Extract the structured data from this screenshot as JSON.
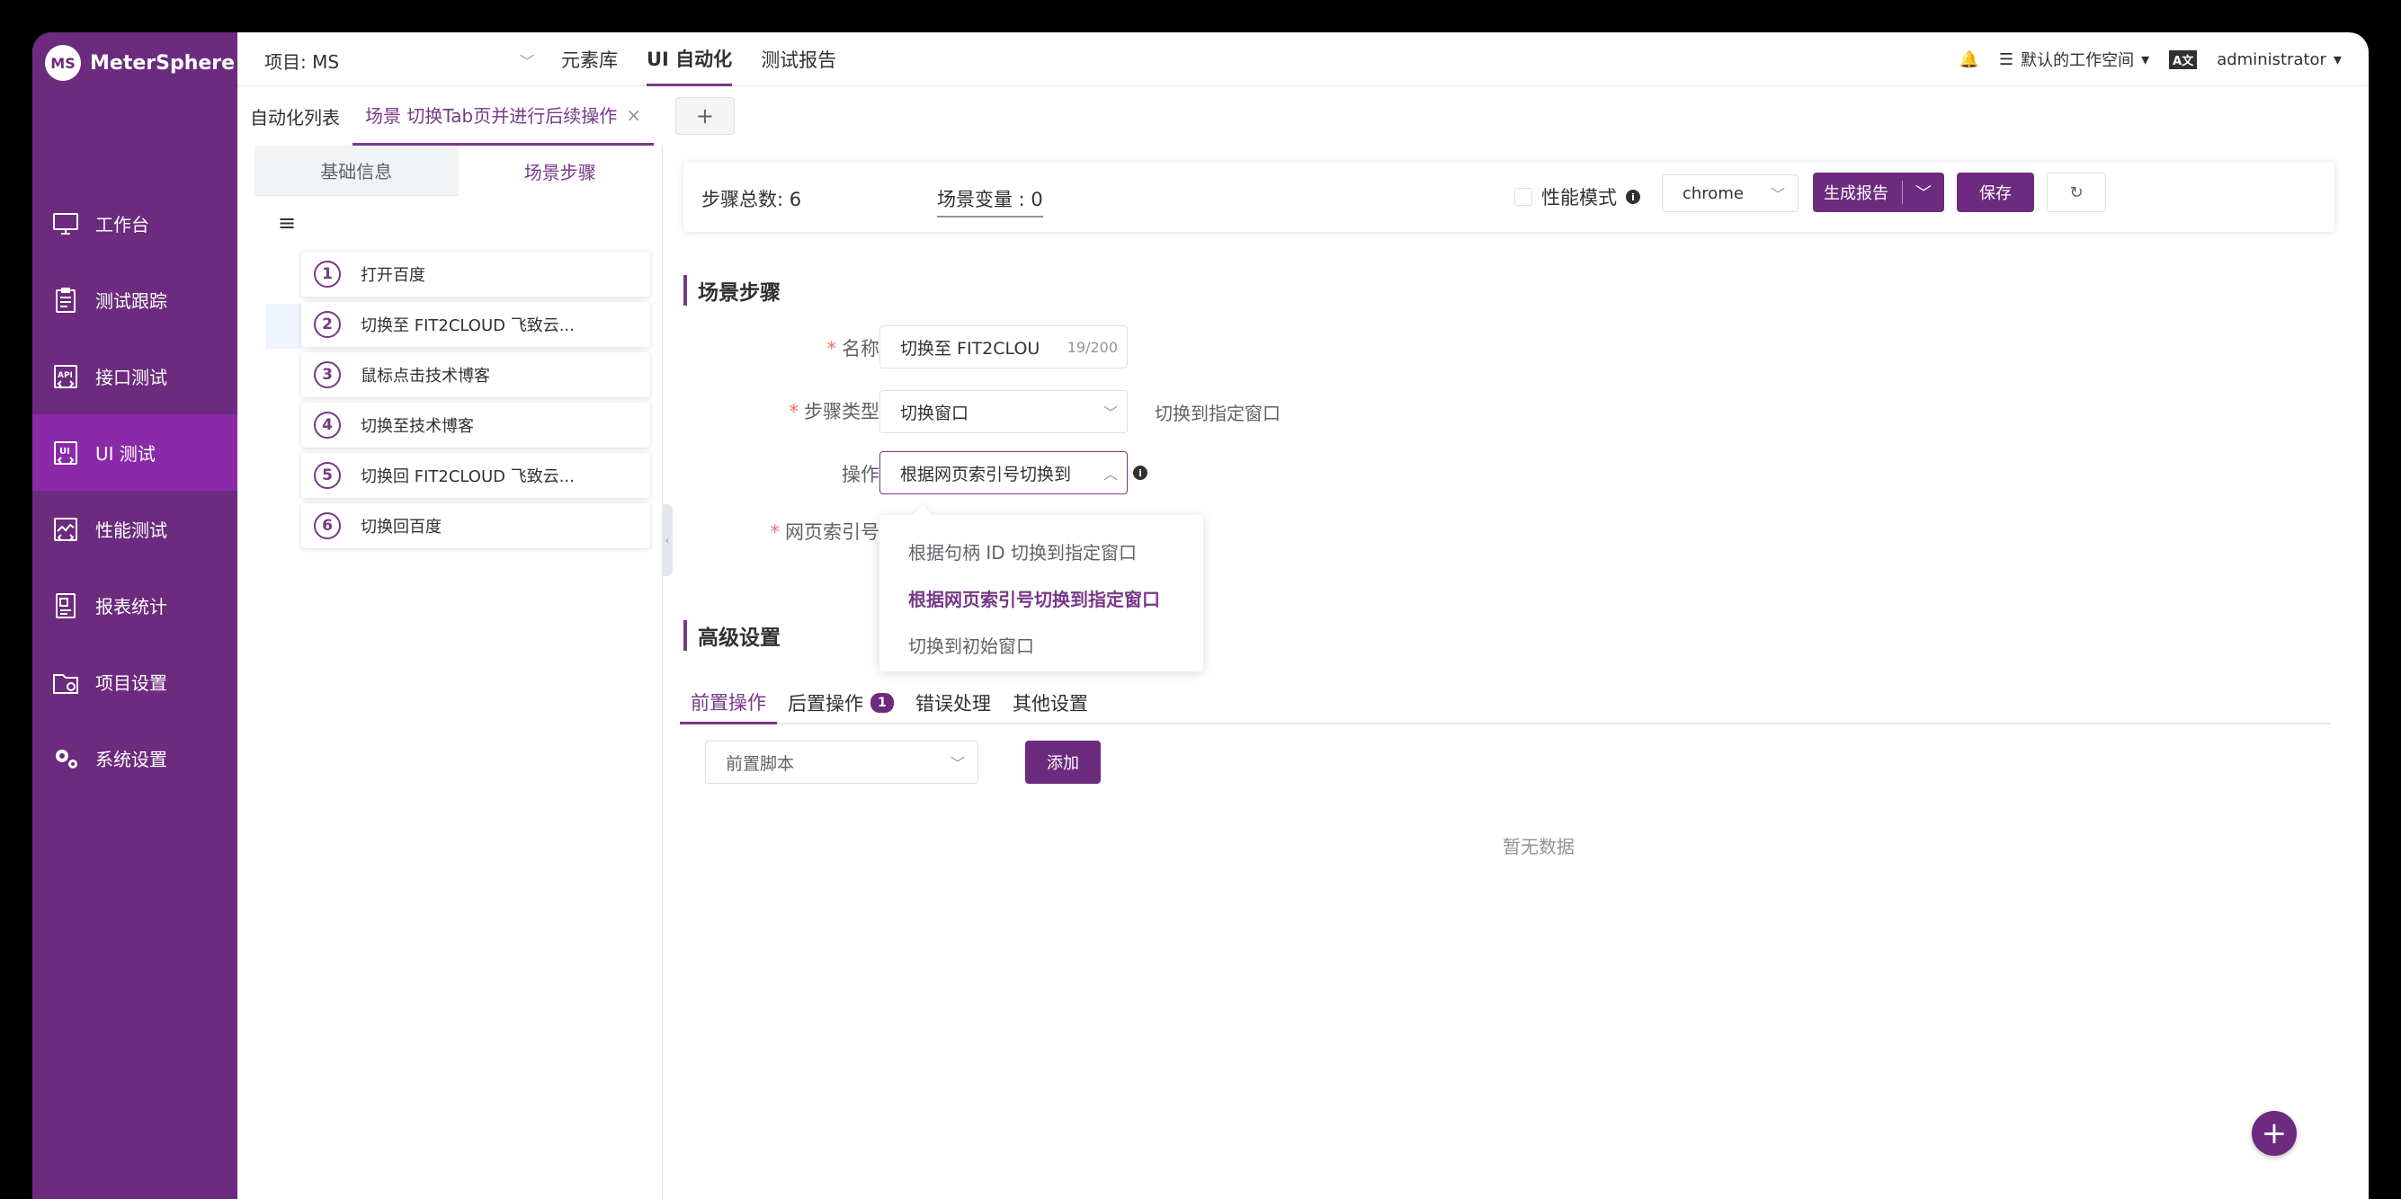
{
  "app": {
    "logo_mark": "MS",
    "name": "MeterSphere"
  },
  "sidebar": {
    "items": [
      {
        "label": "工作台",
        "icon": "monitor-icon",
        "active": false
      },
      {
        "label": "测试跟踪",
        "icon": "clipboard-icon",
        "active": false
      },
      {
        "label": "接口测试",
        "icon": "api-icon",
        "active": false
      },
      {
        "label": "UI 测试",
        "icon": "ui-icon",
        "active": true
      },
      {
        "label": "性能测试",
        "icon": "chart-icon",
        "active": false
      },
      {
        "label": "报表统计",
        "icon": "report-icon",
        "active": false
      },
      {
        "label": "项目设置",
        "icon": "folder-icon",
        "active": false
      },
      {
        "label": "系统设置",
        "icon": "gears-icon",
        "active": false
      }
    ]
  },
  "header": {
    "project": "项目: MS",
    "menu": [
      "元素库",
      "UI 自动化",
      "测试报告"
    ],
    "active_menu": 1,
    "workspace": "默认的工作空间",
    "lang_icon": "A文",
    "user": "administrator"
  },
  "tabs": {
    "list_label": "自动化列表",
    "active_label": "场景 切换Tab页并进行后续操作",
    "close": "×",
    "add": "+"
  },
  "left_panel": {
    "tab_basic": "基础信息",
    "tab_steps": "场景步骤",
    "menu_glyph": "≡",
    "steps": [
      {
        "num": "1",
        "label": "打开百度"
      },
      {
        "num": "2",
        "label": "切换至 FIT2CLOUD 飞致云..."
      },
      {
        "num": "3",
        "label": "鼠标点击技术博客"
      },
      {
        "num": "4",
        "label": "切换至技术博客"
      },
      {
        "num": "5",
        "label": "切换回 FIT2CLOUD 飞致云..."
      },
      {
        "num": "6",
        "label": "切换回百度"
      }
    ]
  },
  "summary": {
    "total_steps": "步骤总数: 6",
    "scene_vars": "场景变量 : 0",
    "perf_mode": "性能模式",
    "browser": "chrome",
    "report_btn": "生成报告",
    "save_btn": "保存"
  },
  "step_form": {
    "title": "场景步骤",
    "name_label": "名称",
    "name_value": "切换至 FIT2CLOU",
    "name_count": "19/200",
    "type_label": "步骤类型",
    "type_value": "切换窗口",
    "type_hint": "切换到指定窗口",
    "op_label": "操作",
    "op_value": "根据网页索引号切换到",
    "index_label": "网页索引号",
    "options": [
      "根据句柄 ID 切换到指定窗口",
      "根据网页索引号切换到指定窗口",
      "切换到初始窗口"
    ],
    "selected_option": 1
  },
  "advanced": {
    "title": "高级设置",
    "tabs": [
      "前置操作",
      "后置操作",
      "错误处理",
      "其他设置"
    ],
    "post_badge": "1",
    "script_select": "前置脚本",
    "add_btn": "添加",
    "empty": "暂无数据"
  },
  "colors": {
    "brand": "#6c2b7e",
    "sidebar_active": "#8a2aa8",
    "accent": "#783887"
  }
}
